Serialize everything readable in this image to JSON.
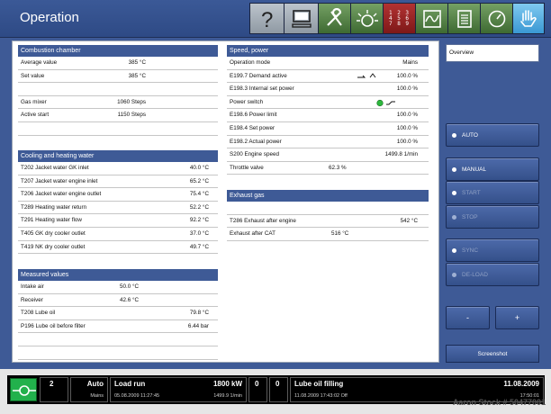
{
  "header": {
    "title": "Operation"
  },
  "toolbar": {
    "keypad_rows": [
      "1 2 3",
      "4 5 6",
      "7 8 9"
    ],
    "icons": [
      "help-icon",
      "monitor-icon",
      "tools-icon",
      "lamp-icon",
      "keypad-icon",
      "trend-icon",
      "report-icon",
      "gauge-icon",
      "hand-icon"
    ]
  },
  "combustion": {
    "title": "Combustion chamber",
    "rows": [
      {
        "label": "Average value",
        "value": "385 °C"
      },
      {
        "label": "Set value",
        "value": "385 °C"
      },
      {
        "label": "",
        "value": ""
      },
      {
        "label": "Gas mixer",
        "value": "1060 Steps"
      },
      {
        "label": "Active start",
        "value": "1150 Steps"
      },
      {
        "label": "",
        "value": ""
      }
    ]
  },
  "cooling": {
    "title": "Cooling and heating water",
    "rows": [
      {
        "label": "T202 Jacket water GK inlet",
        "value": "40.0 °C"
      },
      {
        "label": "T207 Jacket water engine inlet",
        "value": "65.2 °C"
      },
      {
        "label": "T206 Jacket water engine outlet",
        "value": "75.4 °C"
      },
      {
        "label": "T289 Heating water return",
        "value": "52.2 °C"
      },
      {
        "label": "T291 Heating water flow",
        "value": "92.2 °C"
      },
      {
        "label": "T405 GK dry cooler outlet",
        "value": "37.0 °C"
      },
      {
        "label": "T419 NK dry cooler outlet",
        "value": "49.7 °C"
      }
    ]
  },
  "measured": {
    "title": "Measured values",
    "rows": [
      {
        "label": "Intake air",
        "mid": "50.0 °C",
        "value": ""
      },
      {
        "label": "Receiver",
        "mid": "42.6 °C",
        "value": ""
      },
      {
        "label": "T208 Lube oil",
        "mid": "",
        "value": "79.8 °C"
      },
      {
        "label": "P196 Lube oil before filter",
        "mid": "",
        "value": "6.44 bar"
      },
      {
        "label": "",
        "mid": "",
        "value": ""
      },
      {
        "label": "",
        "mid": "",
        "value": ""
      }
    ]
  },
  "speed": {
    "title": "Speed, power",
    "rows": [
      {
        "label": "Operation mode",
        "mid": "",
        "value": "Mains"
      },
      {
        "label": "E199.7 Demand active",
        "mid": "",
        "value": "100.0 %"
      },
      {
        "label": "E198.3 Internal set power",
        "mid": "",
        "value": "100.0 %"
      },
      {
        "label": "Power switch",
        "mid": "",
        "value": ""
      },
      {
        "label": "E198.6 Power limit",
        "mid": "",
        "value": "100.0 %"
      },
      {
        "label": "E198.4 Set power",
        "mid": "",
        "value": "100.0 %"
      },
      {
        "label": "E198.2 Actual power",
        "mid": "",
        "value": "100.0 %"
      },
      {
        "label": "S200 Engine speed",
        "mid": "",
        "value": "1499.8 1/min"
      },
      {
        "label": "Throttle valve",
        "mid": "62.3 %",
        "value": ""
      }
    ],
    "power_switch_color": "#2db83d"
  },
  "exhaust": {
    "title": "Exhaust gas",
    "rows": [
      {
        "label": "",
        "mid": "",
        "value": ""
      },
      {
        "label": "T286 Exhaust after engine",
        "mid": "",
        "value": "542 °C"
      },
      {
        "label": "Exhaust after CAT",
        "mid": "516 °C",
        "value": ""
      }
    ]
  },
  "right_panel": {
    "overview": "Overview",
    "buttons": [
      {
        "label": "AUTO",
        "enabled": true
      },
      {
        "label": "MANUAL",
        "enabled": true
      },
      {
        "label": "START",
        "enabled": false
      },
      {
        "label": "STOP",
        "enabled": false
      },
      {
        "label": "SYNC",
        "enabled": false
      },
      {
        "label": "DE-LOAD",
        "enabled": false
      }
    ],
    "minus": "-",
    "plus": "+",
    "screenshot": "Screenshot"
  },
  "statusbar": {
    "count": "2",
    "mode_main": "Auto",
    "mode_sub": "Mains",
    "load_main": "Load run",
    "load_sub": "05.08.2009   11:27:45",
    "power_main": "1800 kW",
    "power_sub": "1499.9 1/min",
    "count2": "0",
    "count3": "0",
    "msg_main": "Lube oil filling",
    "msg_sub": "11.08.2009 17:43:02 Off",
    "date_main": "11.08.2009",
    "date_sub": "17:50:01"
  },
  "watermark": "Aaron Stock # 50477001",
  "colors": {
    "header": "#3b5997",
    "section": "#3e5a96",
    "status_green": "#22b14c"
  }
}
